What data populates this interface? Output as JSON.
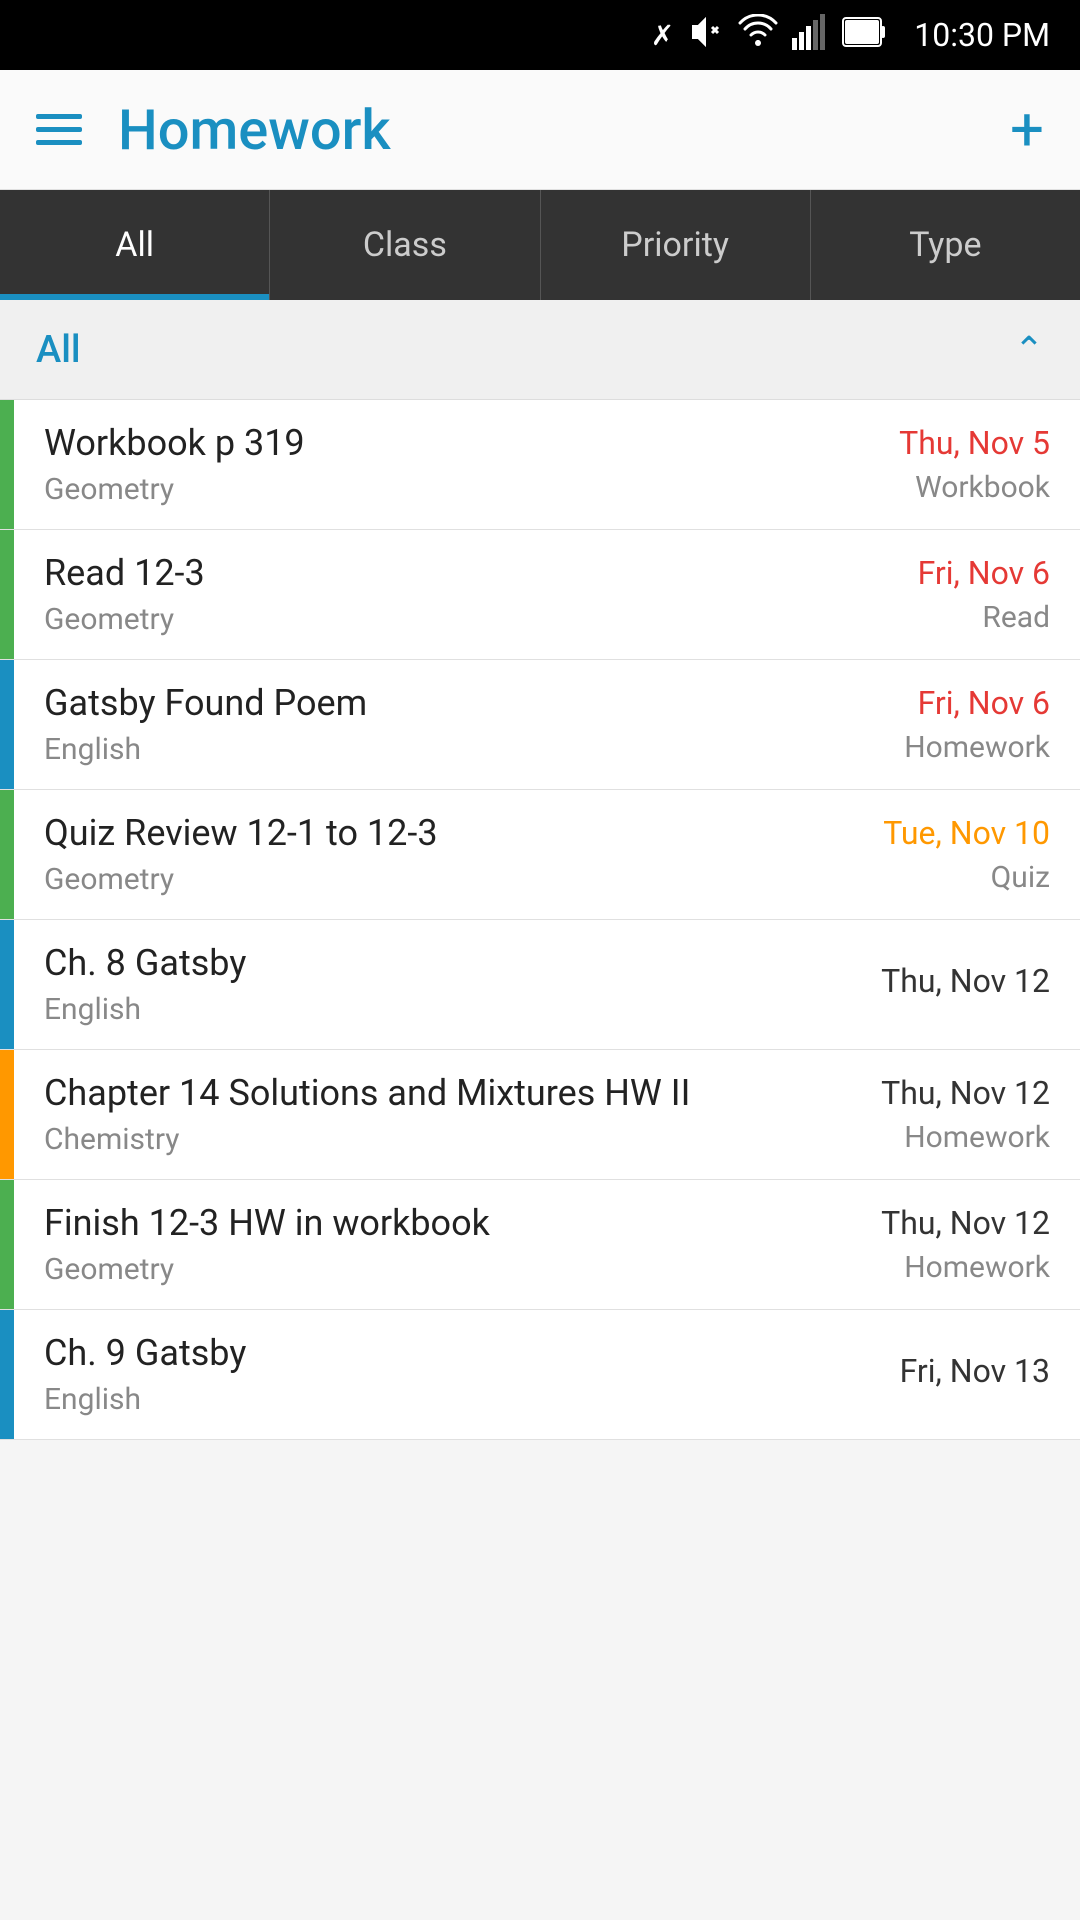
{
  "statusBar": {
    "time": "10:30 PM"
  },
  "header": {
    "title": "Homework",
    "addLabel": "+"
  },
  "tabs": [
    {
      "id": "all",
      "label": "All",
      "active": true
    },
    {
      "id": "class",
      "label": "Class",
      "active": false
    },
    {
      "id": "priority",
      "label": "Priority",
      "active": false
    },
    {
      "id": "type",
      "label": "Type",
      "active": false
    }
  ],
  "sectionHeader": {
    "label": "All"
  },
  "homeworkItems": [
    {
      "id": 1,
      "title": "Workbook p 319",
      "class": "Geometry",
      "date": "Thu, Nov 5",
      "dateColor": "red",
      "type": "Workbook",
      "colorBar": "green"
    },
    {
      "id": 2,
      "title": "Read 12-3",
      "class": "Geometry",
      "date": "Fri, Nov 6",
      "dateColor": "red",
      "type": "Read",
      "colorBar": "green"
    },
    {
      "id": 3,
      "title": "Gatsby Found Poem",
      "class": "English",
      "date": "Fri, Nov 6",
      "dateColor": "red",
      "type": "Homework",
      "colorBar": "blue"
    },
    {
      "id": 4,
      "title": "Quiz Review 12-1 to 12-3",
      "class": "Geometry",
      "date": "Tue, Nov 10",
      "dateColor": "orange",
      "type": "Quiz",
      "colorBar": "green"
    },
    {
      "id": 5,
      "title": "Ch. 8 Gatsby",
      "class": "English",
      "date": "Thu, Nov 12",
      "dateColor": "normal",
      "type": "",
      "colorBar": "blue"
    },
    {
      "id": 6,
      "title": "Chapter 14 Solutions and Mixtures HW II",
      "class": "Chemistry",
      "date": "Thu, Nov 12",
      "dateColor": "normal",
      "type": "Homework",
      "colorBar": "orange"
    },
    {
      "id": 7,
      "title": "Finish 12-3 HW in workbook",
      "class": "Geometry",
      "date": "Thu, Nov 12",
      "dateColor": "normal",
      "type": "Homework",
      "colorBar": "green"
    },
    {
      "id": 8,
      "title": "Ch. 9 Gatsby",
      "class": "English",
      "date": "Fri, Nov 13",
      "dateColor": "normal",
      "type": "",
      "colorBar": "blue"
    }
  ]
}
